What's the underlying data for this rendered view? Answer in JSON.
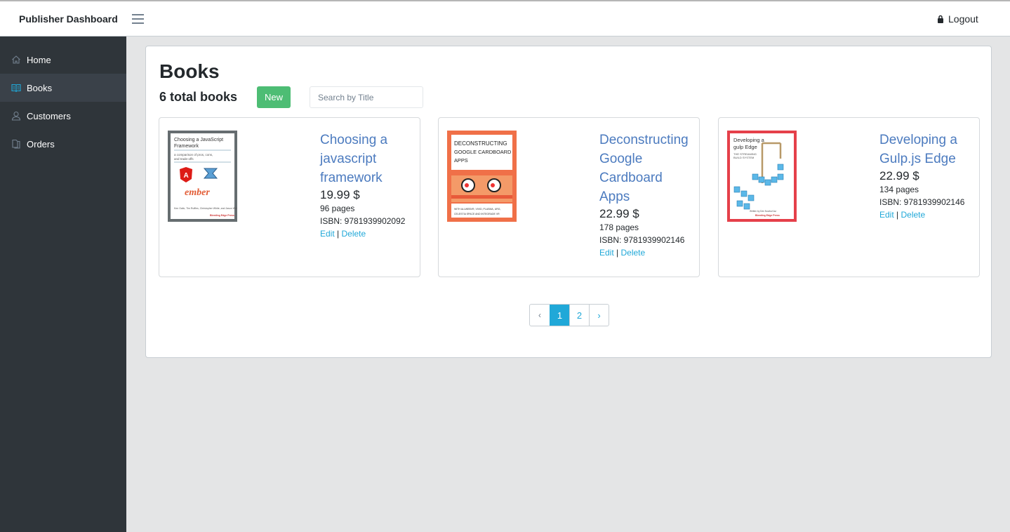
{
  "header": {
    "brand": "Publisher Dashboard",
    "logout_label": "Logout"
  },
  "sidebar": {
    "items": [
      {
        "label": "Home",
        "icon": "home-icon"
      },
      {
        "label": "Books",
        "icon": "book-icon",
        "active": true
      },
      {
        "label": "Customers",
        "icon": "user-icon"
      },
      {
        "label": "Orders",
        "icon": "orders-icon"
      }
    ]
  },
  "main": {
    "title": "Books",
    "total": "6 total books",
    "new_label": "New",
    "search_placeholder": "Search by Title"
  },
  "books": [
    {
      "title": "Choosing a javascript framework",
      "price": "19.99 $",
      "pages": "96 pages",
      "isbn": "ISBN: 9781939902092",
      "edit": "Edit",
      "sep": "|",
      "delete": "Delete",
      "cover": {
        "text": "Choosing a JavaScript Framework",
        "sub": "a comparison of pros, cons, and trade-offs",
        "mark": "ember",
        "color": "#666d70"
      }
    },
    {
      "title": "Deconstructing Google Cardboard Apps",
      "price": "22.99 $",
      "pages": "178 pages",
      "isbn": "ISBN: 9781939902146",
      "edit": "Edit",
      "sep": "|",
      "delete": "Delete",
      "cover": {
        "text": "DECONSTRUCTING GOOGLE CARDBOARD APPS",
        "color": "#f07048"
      }
    },
    {
      "title": "Developing a Gulp.js Edge",
      "price": "22.99 $",
      "pages": "134 pages",
      "isbn": "ISBN: 9781939902146",
      "edit": "Edit",
      "sep": "|",
      "delete": "Delete",
      "cover": {
        "text": "Developing a gulp Edge",
        "sub": "THE STREAMING BUILD SYSTEM",
        "color": "#e5404a"
      }
    }
  ],
  "pagination": {
    "prev": "‹",
    "pages": [
      "1",
      "2"
    ],
    "next": "›",
    "current": "1"
  },
  "colors": {
    "sidebar": "#2f353a",
    "accent": "#20a8d8",
    "success": "#4dbd74",
    "title_link": "#4c7bbf"
  }
}
